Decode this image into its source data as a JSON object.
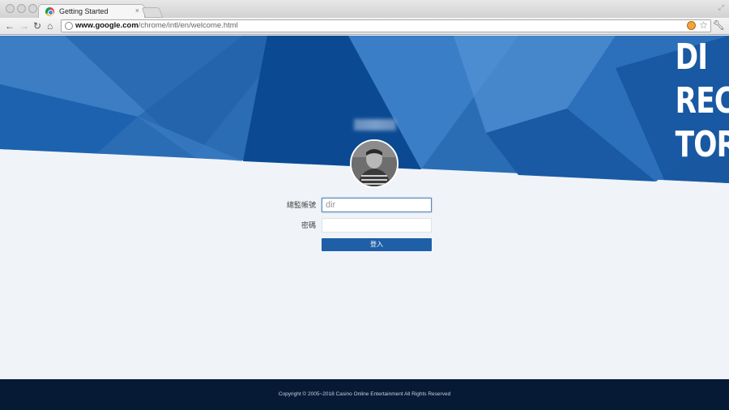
{
  "browser": {
    "tab_title": "Getting Started",
    "tab_close": "×",
    "url_host": "www.google.com",
    "url_path": "/chrome/intl/en/welcome.html"
  },
  "login": {
    "username_label": "總監帳號",
    "username_value": "dir",
    "password_label": "密碼",
    "submit_label": "登入"
  },
  "hero": {
    "lines": [
      "DI",
      "REC",
      "TOR"
    ]
  },
  "footer": {
    "copyright": "Copyright © 2005~2018 Casino Online Entertainment All Rights Reserved"
  },
  "colors": {
    "hero_dark": "#0d4f99",
    "hero_light": "#3a7fc6",
    "button": "#1f5fa8",
    "footer": "#071a35",
    "page_bg": "#f0f4f8"
  }
}
